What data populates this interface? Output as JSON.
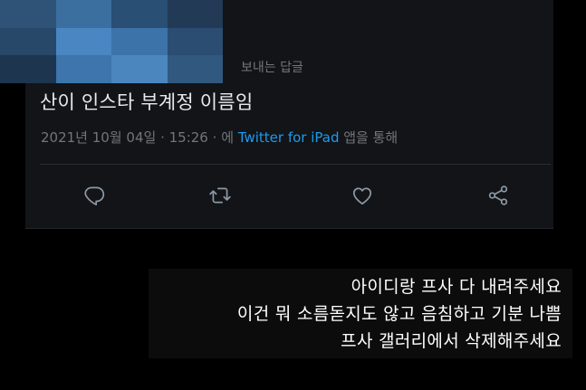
{
  "tweet": {
    "reply_context": "보내는 답글",
    "text": "산이 인스타 부계정 이름임",
    "date": "2021년 10월 04일",
    "time": "15:26",
    "via_prefix": "에",
    "source": "Twitter for iPad",
    "via_suffix": "앱을 통해",
    "actions": {
      "reply": "reply-icon",
      "retweet": "retweet-icon",
      "like": "heart-icon",
      "share": "share-icon"
    }
  },
  "caption": {
    "lines": [
      "아이디랑 프사 다 내려주세요",
      "이건 뭐 소름돋지도 않고 음침하고 기분 나쁨",
      "프사 갤러리에서 삭제해주세요"
    ]
  },
  "colors": {
    "background": "#000000",
    "card": "#121417",
    "text_primary": "#e7e9ea",
    "text_secondary": "#71767b",
    "link": "#1d9bf0"
  }
}
